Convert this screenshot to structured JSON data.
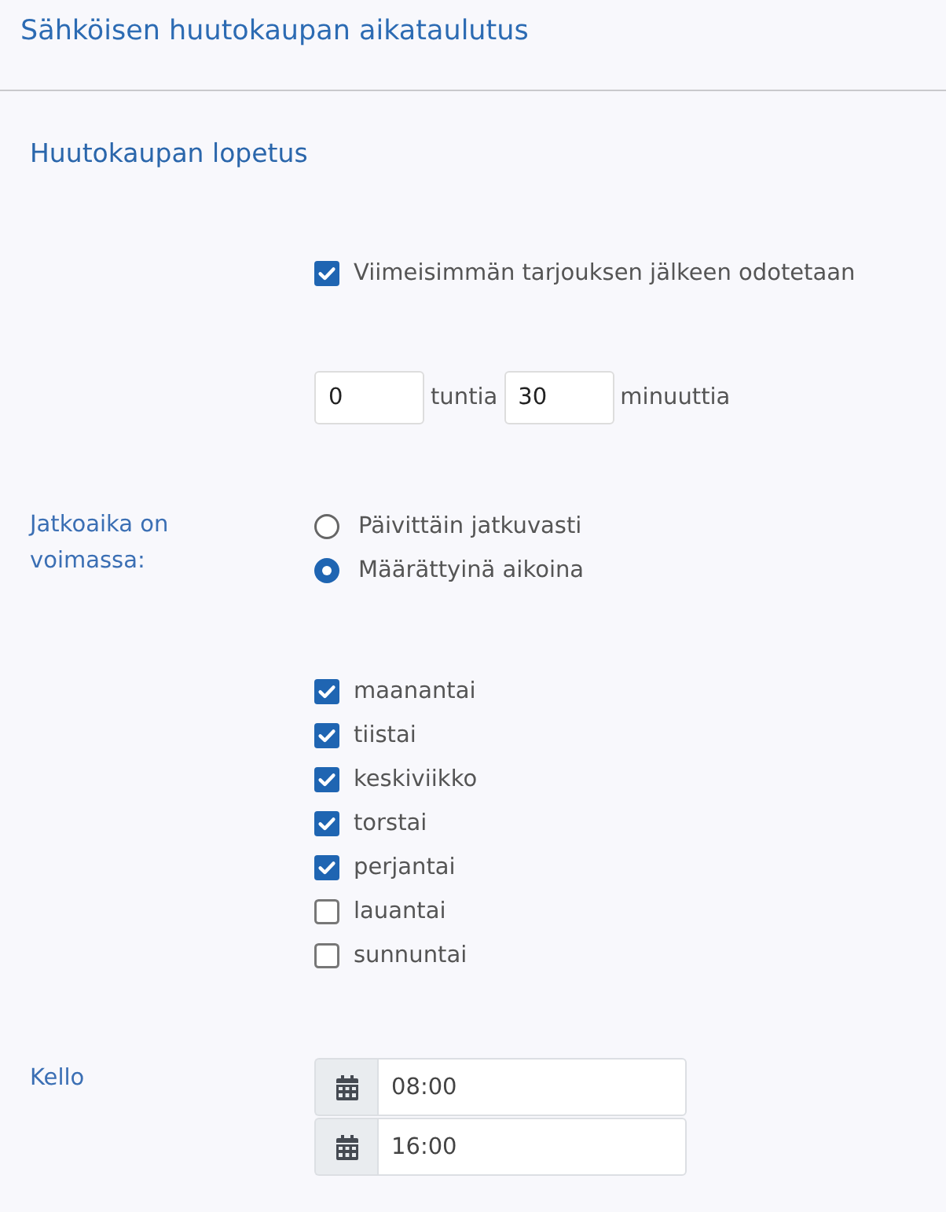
{
  "header": {
    "title": "Sähköisen huutokaupan aikataulutus"
  },
  "section": {
    "title": "Huutokaupan lopetus"
  },
  "extension": {
    "label": "Viimeisimmän tarjouksen jälkeen odotetaan",
    "checked": true
  },
  "wait_time": [
    {
      "value": "0",
      "unit": "tuntia"
    },
    {
      "value": "30",
      "unit": "minuuttia"
    }
  ],
  "validity": {
    "label": "Jatkoaika on voimassa:",
    "options": [
      {
        "label": "Päivittäin jatkuvasti",
        "selected": false
      },
      {
        "label": "Määrättyinä aikoina",
        "selected": true
      }
    ]
  },
  "days": [
    {
      "label": "maanantai",
      "checked": true
    },
    {
      "label": "tiistai",
      "checked": true
    },
    {
      "label": "keskiviikko",
      "checked": true
    },
    {
      "label": "torstai",
      "checked": true
    },
    {
      "label": "perjantai",
      "checked": true
    },
    {
      "label": "lauantai",
      "checked": false
    },
    {
      "label": "sunnuntai",
      "checked": false
    }
  ],
  "clock": {
    "label": "Kello",
    "times": [
      {
        "value": "08:00"
      },
      {
        "value": "16:00"
      }
    ]
  }
}
